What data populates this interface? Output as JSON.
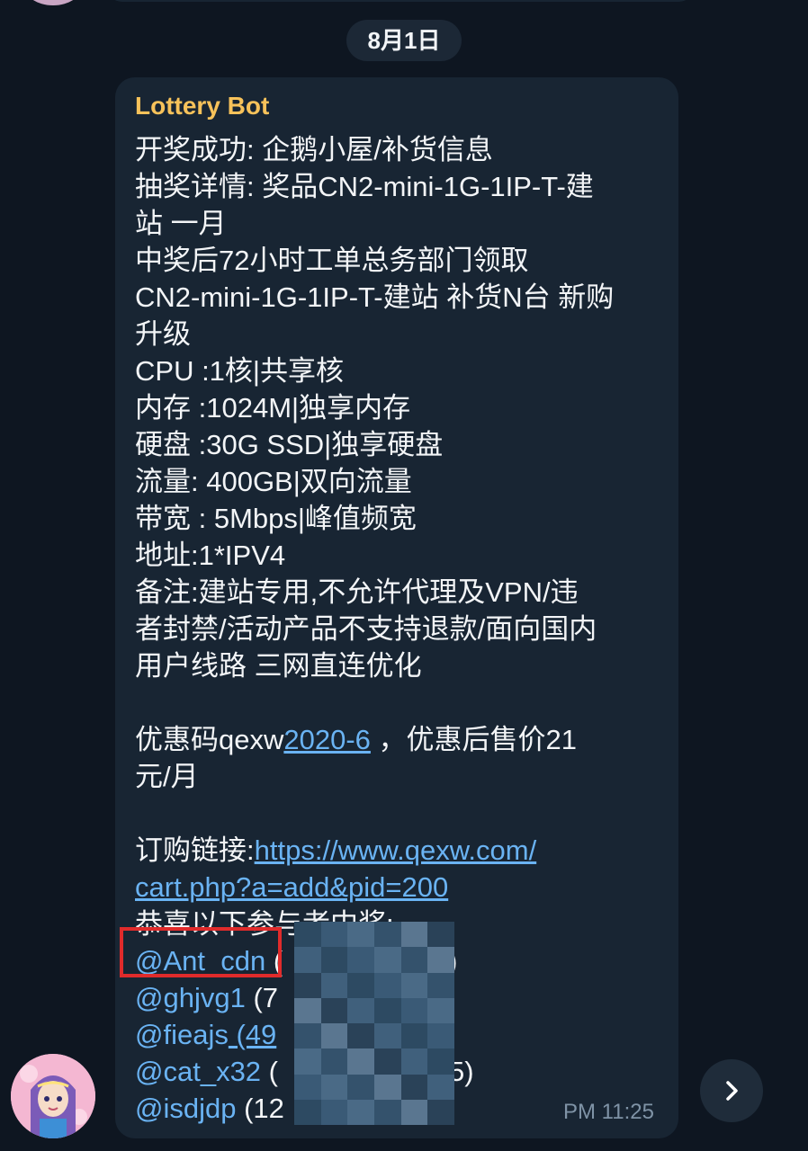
{
  "date_chip": "8月1日",
  "message": {
    "sender": "Lottery Bot",
    "lines": [
      "开奖成功: 企鹅小屋/补货信息",
      "抽奖详情: 奖品CN2-mini-1G-1IP-T-建",
      "站 一月",
      "中奖后72小时工单总务部门领取",
      "CN2-mini-1G-1IP-T-建站 补货N台 新购",
      "升级",
      "CPU :1核|共享核",
      "内存 :1024M|独享内存",
      "硬盘 :30G SSD|独享硬盘",
      "流量: 400GB|双向流量",
      "带宽 : 5Mbps|峰值频宽",
      "地址:1*IPV4",
      "备注:建站专用,不允许代理及VPN/违",
      "者封禁/活动产品不支持退款/面向国内",
      "用户线路 三网直连优化"
    ],
    "promo": {
      "prefix": "优惠码qexw",
      "code_link": "2020-6",
      "suffix": " ，优惠后售价21",
      "line2": "元/月"
    },
    "order": {
      "label": "订购链接:",
      "url_part1": "https://www.qexw.com/",
      "url_part2": "cart.php?a=add&pid=200"
    },
    "winners_header": "恭喜以下参与者中奖:",
    "winners": [
      {
        "handle": "@Ant_cdn",
        "rest": " (",
        "tail": ")"
      },
      {
        "handle": "@ghjvg1",
        "rest": " (7",
        "tail": ""
      },
      {
        "handle": "@fieajs",
        "rest": " (49",
        "tail": ""
      },
      {
        "handle": "@cat_x32",
        "rest": " (",
        "tail": "5)"
      },
      {
        "handle": "@isdjdp",
        "rest": " (12",
        "tail": ""
      }
    ],
    "time": "PM 11:25"
  },
  "colors": {
    "background": "#0e1621",
    "bubble": "#182533",
    "sender": "#f7c25a",
    "link": "#6ab3f3",
    "highlight_box": "#e02b2b"
  },
  "icons": {
    "scroll_down": "chevron-right-icon",
    "avatar": "user-avatar"
  }
}
